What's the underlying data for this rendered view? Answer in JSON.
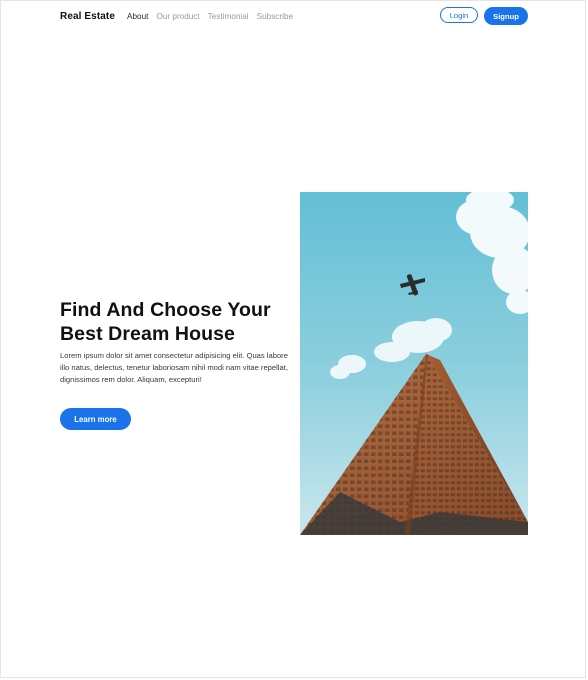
{
  "nav": {
    "brand": "Real Estate",
    "links": [
      "About",
      "Our product",
      "Testimonial",
      "Subscribe"
    ],
    "login_label": "Login",
    "signup_label": "Signup"
  },
  "hero": {
    "title_line1": "Find And Choose Your",
    "title_line2": "Best Dream House",
    "description": "Lorem ipsum dolor sit amet consectetur adipisicing elit. Quas labore illo natus, delectus, tenetur laboriosam nihil modi nam vitae repellat, dignissimos rem dolor. Aliquam, excepturi!",
    "cta_label": "Learn more"
  },
  "colors": {
    "accent": "#1a73e8",
    "sky": "#6ec6d9",
    "building": "#b0663a"
  }
}
